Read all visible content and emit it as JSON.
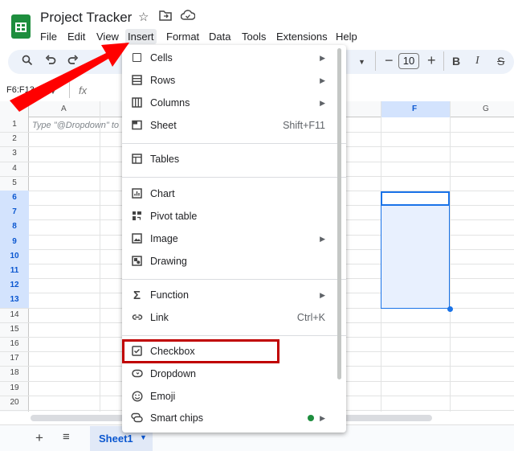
{
  "header": {
    "title": "Project Tracker",
    "menus": [
      "File",
      "Edit",
      "View",
      "Insert",
      "Format",
      "Data",
      "Tools",
      "Extensions",
      "Help"
    ]
  },
  "toolbar": {
    "font_size": "10",
    "minus": "−",
    "plus": "+",
    "bold": "B",
    "italic": "I",
    "strike": "S"
  },
  "formula_bar": {
    "name_box": "F6:F13",
    "fx": "fx"
  },
  "grid": {
    "columns": [
      "A",
      "F",
      "G"
    ],
    "rows": [
      "1",
      "2",
      "3",
      "4",
      "5",
      "6",
      "7",
      "8",
      "9",
      "10",
      "11",
      "12",
      "13",
      "14",
      "15",
      "16",
      "17",
      "18",
      "19",
      "20"
    ],
    "selected_rows": [
      "6",
      "7",
      "8",
      "9",
      "10",
      "11",
      "12",
      "13"
    ],
    "cell_a1_placeholder": "Type \"@Dropdown\" to"
  },
  "sheets": {
    "active": "Sheet1"
  },
  "insert_menu": {
    "items": [
      {
        "label": "Cells",
        "shortcut": "",
        "submenu": true,
        "icon": "cell-square-icon"
      },
      {
        "label": "Rows",
        "shortcut": "",
        "submenu": true,
        "icon": "rows-icon"
      },
      {
        "label": "Columns",
        "shortcut": "",
        "submenu": true,
        "icon": "columns-icon"
      },
      {
        "label": "Sheet",
        "shortcut": "Shift+F11",
        "submenu": false,
        "icon": "sheet-icon"
      },
      {
        "label": "Tables",
        "shortcut": "",
        "submenu": false,
        "icon": "table-icon"
      },
      {
        "label": "Chart",
        "shortcut": "",
        "submenu": false,
        "icon": "chart-icon"
      },
      {
        "label": "Pivot table",
        "shortcut": "",
        "submenu": false,
        "icon": "pivot-icon"
      },
      {
        "label": "Image",
        "shortcut": "",
        "submenu": true,
        "icon": "image-icon"
      },
      {
        "label": "Drawing",
        "shortcut": "",
        "submenu": false,
        "icon": "drawing-icon"
      },
      {
        "label": "Function",
        "shortcut": "",
        "submenu": true,
        "icon": "sigma-icon"
      },
      {
        "label": "Link",
        "shortcut": "Ctrl+K",
        "submenu": false,
        "icon": "link-icon"
      },
      {
        "label": "Checkbox",
        "shortcut": "",
        "submenu": false,
        "icon": "checkbox-icon"
      },
      {
        "label": "Dropdown",
        "shortcut": "",
        "submenu": false,
        "icon": "dropdown-icon"
      },
      {
        "label": "Emoji",
        "shortcut": "",
        "submenu": false,
        "icon": "emoji-icon"
      },
      {
        "label": "Smart chips",
        "shortcut": "",
        "submenu": true,
        "icon": "smart-chips-icon"
      }
    ]
  },
  "colors": {
    "accent": "#1a73e8",
    "sheets_green": "#1e8e3e",
    "annotation_red": "#c00000",
    "arrow_red": "#ff0000"
  }
}
